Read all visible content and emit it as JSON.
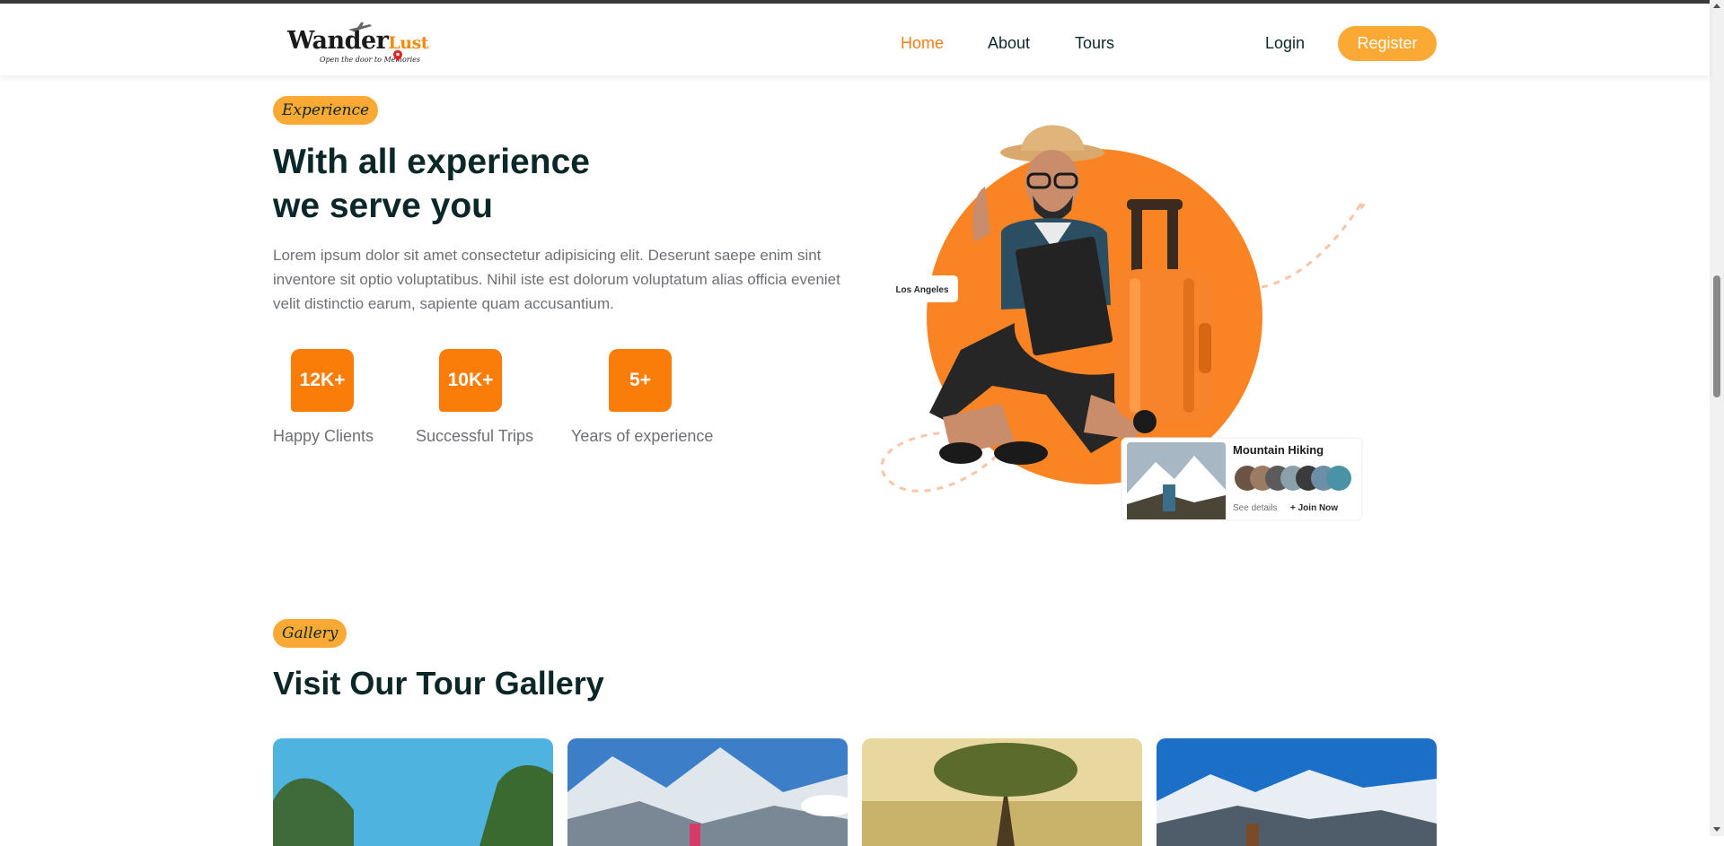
{
  "header": {
    "logo_main": "Wander",
    "logo_accent": "Lust",
    "logo_tagline": "Open the door to Memories",
    "nav": [
      "Home",
      "About",
      "Tours"
    ],
    "login": "Login",
    "register": "Register"
  },
  "experience": {
    "badge": "Experience",
    "title_line1": "With all experience",
    "title_line2": "we serve you",
    "description": "Lorem ipsum dolor sit amet consectetur adipisicing elit. Deserunt saepe enim sint inventore sit optio voluptatibus. Nihil iste est dolorum voluptatum alias officia eveniet velit distinctio earum, sapiente quam accusantium.",
    "stats": [
      {
        "value": "12K+",
        "label": "Happy Clients"
      },
      {
        "value": "10K+",
        "label": "Successful Trips"
      },
      {
        "value": "5+",
        "label": "Years of experience"
      }
    ],
    "hero_card": {
      "location": "Los Angeles",
      "title": "Mountain Hiking",
      "see_details": "See details",
      "join": "+ Join Now"
    }
  },
  "gallery": {
    "badge": "Gallery",
    "title": "Visit Our Tour Gallery"
  },
  "colors": {
    "accent": "#faa935",
    "orange": "#fa7d09",
    "heading": "#0b2727",
    "text": "#6e7074"
  }
}
